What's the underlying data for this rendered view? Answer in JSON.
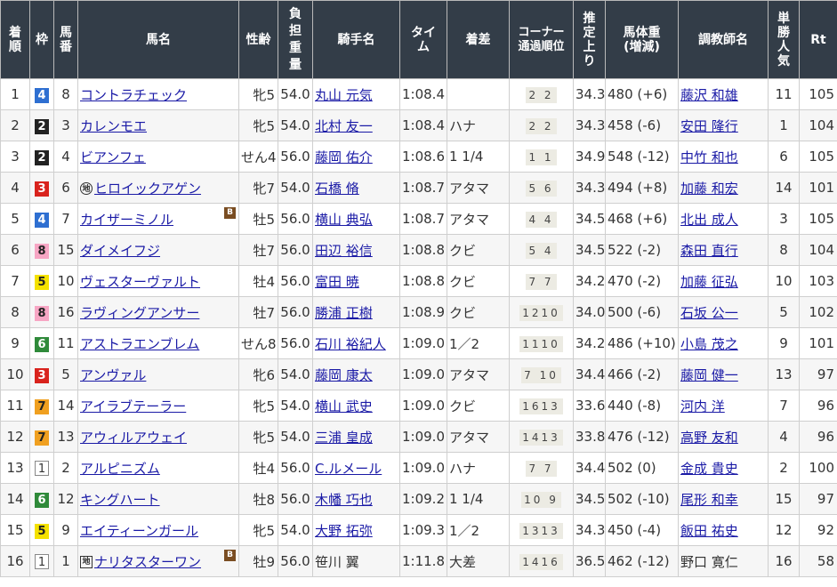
{
  "headers": {
    "rank": "着順",
    "waku": "枠",
    "umaban": "馬番",
    "name": "馬名",
    "sexage": "性齢",
    "weight": "負担重量",
    "jockey": "騎手名",
    "time": "タイム",
    "margin": "着差",
    "corner": "コーナー通過順位",
    "last3f": "推定上り",
    "bodyweight_l1": "馬体重",
    "bodyweight_l2": "(増減)",
    "trainer": "調教師名",
    "pop": "単勝人気",
    "rt": "Rt"
  },
  "colors": {
    "header_bg": "#333d48",
    "link": "#1a1aa6",
    "blinker_badge": "#7a4d22"
  },
  "rows": [
    {
      "rank": "1",
      "waku": "4",
      "umaban": "8",
      "name": "コントラチェック",
      "prefix": "",
      "blinker": "",
      "sexage": "牝5",
      "weight": "54.0",
      "jockey": "丸山 元気",
      "jockey_link": true,
      "time": "1:08.4",
      "margin": "",
      "corner": "2 2",
      "last3f": "34.3",
      "bodyweight": "480 (+6)",
      "trainer": "藤沢 和雄",
      "trainer_link": true,
      "pop": "11",
      "rt": "105"
    },
    {
      "rank": "2",
      "waku": "2",
      "umaban": "3",
      "name": "カレンモエ",
      "prefix": "",
      "blinker": "",
      "sexage": "牝5",
      "weight": "54.0",
      "jockey": "北村 友一",
      "jockey_link": true,
      "time": "1:08.4",
      "margin": "ハナ",
      "corner": "2 2",
      "last3f": "34.3",
      "bodyweight": "458 (-6)",
      "trainer": "安田 隆行",
      "trainer_link": true,
      "pop": "1",
      "rt": "104"
    },
    {
      "rank": "3",
      "waku": "2",
      "umaban": "4",
      "name": "ビアンフェ",
      "prefix": "",
      "blinker": "",
      "sexage": "せん4",
      "weight": "56.0",
      "jockey": "藤岡 佑介",
      "jockey_link": true,
      "time": "1:08.6",
      "margin": "1 1/4",
      "corner": "1 1",
      "last3f": "34.9",
      "bodyweight": "548 (-12)",
      "trainer": "中竹 和也",
      "trainer_link": true,
      "pop": "6",
      "rt": "105"
    },
    {
      "rank": "4",
      "waku": "3",
      "umaban": "6",
      "name": "ヒロイックアゲン",
      "prefix": "地",
      "prefix_shape": "circle",
      "blinker": "",
      "sexage": "牝7",
      "weight": "54.0",
      "jockey": "石橋 脩",
      "jockey_link": true,
      "time": "1:08.7",
      "margin": "アタマ",
      "corner": "5 6",
      "last3f": "34.3",
      "bodyweight": "494 (+8)",
      "trainer": "加藤 和宏",
      "trainer_link": true,
      "pop": "14",
      "rt": "101"
    },
    {
      "rank": "5",
      "waku": "4",
      "umaban": "7",
      "name": "カイザーミノル",
      "prefix": "",
      "blinker": "B",
      "sexage": "牡5",
      "weight": "56.0",
      "jockey": "横山 典弘",
      "jockey_link": true,
      "time": "1:08.7",
      "margin": "アタマ",
      "corner": "4 4",
      "last3f": "34.5",
      "bodyweight": "468 (+6)",
      "trainer": "北出 成人",
      "trainer_link": true,
      "pop": "3",
      "rt": "105"
    },
    {
      "rank": "6",
      "waku": "8",
      "umaban": "15",
      "name": "ダイメイフジ",
      "prefix": "",
      "blinker": "",
      "sexage": "牡7",
      "weight": "56.0",
      "jockey": "田辺 裕信",
      "jockey_link": true,
      "time": "1:08.8",
      "margin": "クビ",
      "corner": "5 4",
      "last3f": "34.5",
      "bodyweight": "522 (-2)",
      "trainer": "森田 直行",
      "trainer_link": true,
      "pop": "8",
      "rt": "104"
    },
    {
      "rank": "7",
      "waku": "5",
      "umaban": "10",
      "name": "ヴェスターヴァルト",
      "prefix": "",
      "blinker": "",
      "sexage": "牡4",
      "weight": "56.0",
      "jockey": "富田 暁",
      "jockey_link": true,
      "time": "1:08.8",
      "margin": "クビ",
      "corner": "7 7",
      "last3f": "34.2",
      "bodyweight": "470 (-2)",
      "trainer": "加藤 征弘",
      "trainer_link": true,
      "pop": "10",
      "rt": "103"
    },
    {
      "rank": "8",
      "waku": "8",
      "umaban": "16",
      "name": "ラヴィングアンサー",
      "prefix": "",
      "blinker": "",
      "sexage": "牡7",
      "weight": "56.0",
      "jockey": "勝浦 正樹",
      "jockey_link": true,
      "time": "1:08.9",
      "margin": "クビ",
      "corner": "1210",
      "last3f": "34.0",
      "bodyweight": "500 (-6)",
      "trainer": "石坂 公一",
      "trainer_link": true,
      "pop": "5",
      "rt": "102"
    },
    {
      "rank": "9",
      "waku": "6",
      "umaban": "11",
      "name": "アストラエンブレム",
      "prefix": "",
      "blinker": "",
      "sexage": "せん8",
      "weight": "56.0",
      "jockey": "石川 裕紀人",
      "jockey_link": true,
      "time": "1:09.0",
      "margin": "1／2",
      "corner": "1110",
      "last3f": "34.2",
      "bodyweight": "486 (+10)",
      "trainer": "小島 茂之",
      "trainer_link": true,
      "pop": "9",
      "rt": "101"
    },
    {
      "rank": "10",
      "waku": "3",
      "umaban": "5",
      "name": "アンヴァル",
      "prefix": "",
      "blinker": "",
      "sexage": "牝6",
      "weight": "54.0",
      "jockey": "藤岡 康太",
      "jockey_link": true,
      "time": "1:09.0",
      "margin": "アタマ",
      "corner": "7 10",
      "last3f": "34.4",
      "bodyweight": "466 (-2)",
      "trainer": "藤岡 健一",
      "trainer_link": true,
      "pop": "13",
      "rt": "97"
    },
    {
      "rank": "11",
      "waku": "7",
      "umaban": "14",
      "name": "アイラブテーラー",
      "prefix": "",
      "blinker": "",
      "sexage": "牝5",
      "weight": "54.0",
      "jockey": "横山 武史",
      "jockey_link": true,
      "time": "1:09.0",
      "margin": "クビ",
      "corner": "1613",
      "last3f": "33.6",
      "bodyweight": "440 (-8)",
      "trainer": "河内 洋",
      "trainer_link": true,
      "pop": "7",
      "rt": "96"
    },
    {
      "rank": "12",
      "waku": "7",
      "umaban": "13",
      "name": "アウィルアウェイ",
      "prefix": "",
      "blinker": "",
      "sexage": "牝5",
      "weight": "54.0",
      "jockey": "三浦 皇成",
      "jockey_link": true,
      "time": "1:09.0",
      "margin": "アタマ",
      "corner": "1413",
      "last3f": "33.8",
      "bodyweight": "476 (-12)",
      "trainer": "高野 友和",
      "trainer_link": true,
      "pop": "4",
      "rt": "96"
    },
    {
      "rank": "13",
      "waku": "1",
      "umaban": "2",
      "name": "アルピニズム",
      "prefix": "",
      "blinker": "",
      "sexage": "牡4",
      "weight": "56.0",
      "jockey": "C.ルメール",
      "jockey_link": true,
      "time": "1:09.0",
      "margin": "ハナ",
      "corner": "7 7",
      "last3f": "34.4",
      "bodyweight": "502 (0)",
      "trainer": "金成 貴史",
      "trainer_link": true,
      "pop": "2",
      "rt": "100"
    },
    {
      "rank": "14",
      "waku": "6",
      "umaban": "12",
      "name": "キングハート",
      "prefix": "",
      "blinker": "",
      "sexage": "牡8",
      "weight": "56.0",
      "jockey": "木幡 巧也",
      "jockey_link": true,
      "time": "1:09.2",
      "margin": "1 1/4",
      "corner": "10 9",
      "last3f": "34.5",
      "bodyweight": "502 (-10)",
      "trainer": "尾形 和幸",
      "trainer_link": true,
      "pop": "15",
      "rt": "97"
    },
    {
      "rank": "15",
      "waku": "5",
      "umaban": "9",
      "name": "エイティーンガール",
      "prefix": "",
      "blinker": "",
      "sexage": "牝5",
      "weight": "54.0",
      "jockey": "大野 拓弥",
      "jockey_link": true,
      "time": "1:09.3",
      "margin": "1／2",
      "corner": "1313",
      "last3f": "34.3",
      "bodyweight": "450 (-4)",
      "trainer": "飯田 祐史",
      "trainer_link": true,
      "pop": "12",
      "rt": "92"
    },
    {
      "rank": "16",
      "waku": "1",
      "umaban": "1",
      "name": "ナリタスターワン",
      "prefix": "地",
      "prefix_shape": "square",
      "blinker": "B",
      "sexage": "牡9",
      "weight": "56.0",
      "jockey": "笹川 翼",
      "jockey_link": false,
      "time": "1:11.8",
      "margin": "大差",
      "corner": "1416",
      "last3f": "36.5",
      "bodyweight": "462 (-12)",
      "trainer": "野口 寛仁",
      "trainer_link": false,
      "pop": "16",
      "rt": "58"
    }
  ]
}
